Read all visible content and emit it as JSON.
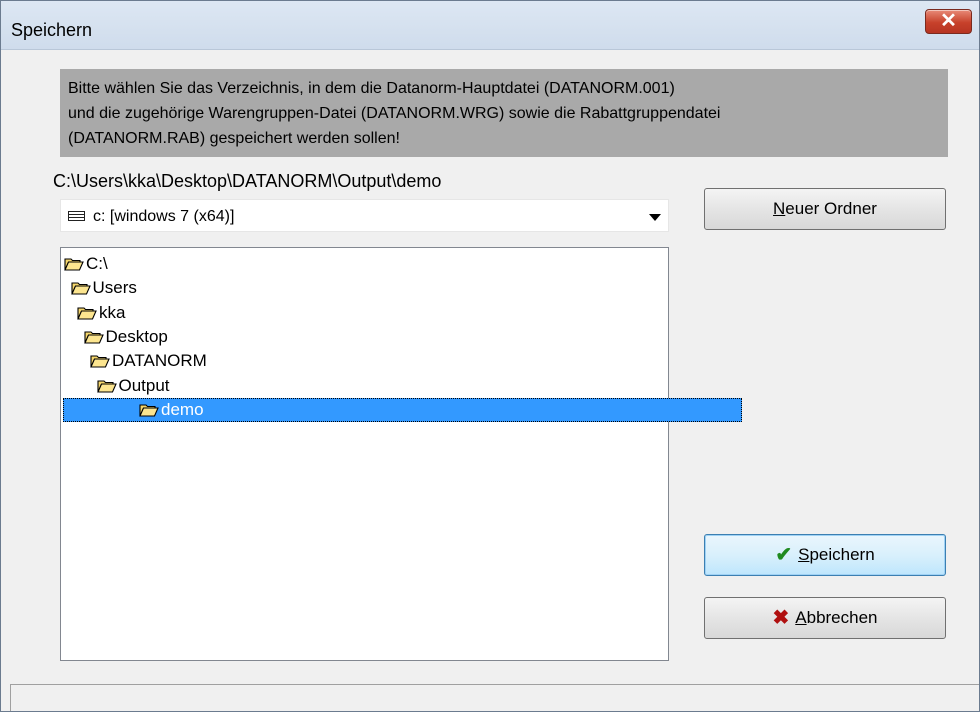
{
  "window": {
    "title": "Speichern",
    "close_glyph": "✕"
  },
  "info": {
    "lines": [
      "Bitte wählen Sie das Verzeichnis, in dem die Datanorm-Hauptdatei (DATANORM.001)",
      "und die zugehörige Warengruppen-Datei (DATANORM.WRG) sowie die Rabattgruppendatei",
      "(DATANORM.RAB) gespeichert werden sollen!"
    ]
  },
  "current_path": "C:\\Users\\kka\\Desktop\\DATANORM\\Output\\demo",
  "drive": {
    "icon": "drive-icon",
    "selected": "c: [windows 7 (x64)]"
  },
  "tree": {
    "icon": "folder-open-icon",
    "items": [
      {
        "label": "C:\\",
        "depth": 0
      },
      {
        "label": "Users",
        "depth": 1
      },
      {
        "label": "kka",
        "depth": 2
      },
      {
        "label": "Desktop",
        "depth": 3
      },
      {
        "label": "DATANORM",
        "depth": 4
      },
      {
        "label": "Output",
        "depth": 5
      },
      {
        "label": "demo",
        "depth": 6,
        "selected": true
      }
    ]
  },
  "buttons": {
    "new_folder": {
      "accel": "N",
      "rest": "euer Ordner"
    },
    "save": {
      "icon": "checkmark-icon",
      "accel": "S",
      "rest": "peichern",
      "color": "#1f8a1f"
    },
    "cancel": {
      "icon": "x-icon",
      "accel": "A",
      "rest": "bbrechen",
      "color": "#b01010"
    }
  },
  "colors": {
    "selection": "#3399ff",
    "info_background": "#a9a9a9",
    "close_button": "#c7412b"
  }
}
